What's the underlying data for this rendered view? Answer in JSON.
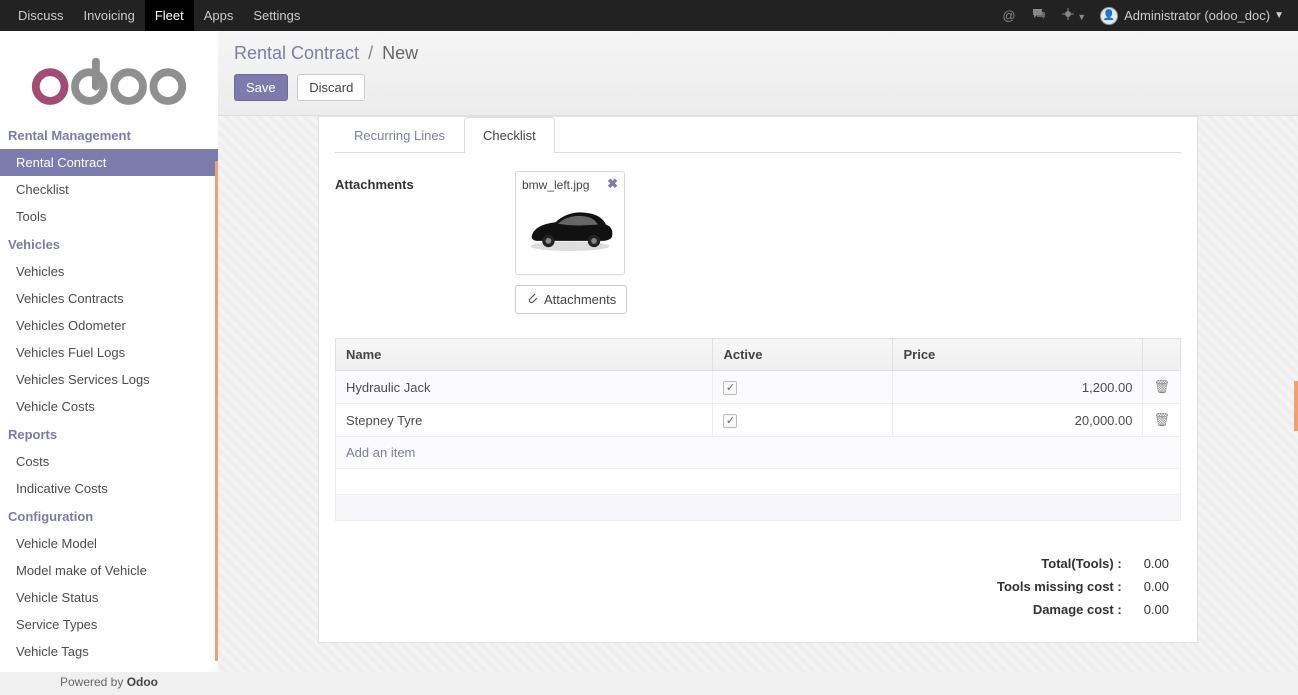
{
  "topnav": {
    "items": [
      "Discuss",
      "Invoicing",
      "Fleet",
      "Apps",
      "Settings"
    ],
    "active_index": 2,
    "user_label": "Administrator (odoo_doc)"
  },
  "sidebar": {
    "sections": [
      {
        "title": "Rental Management",
        "items": [
          "Rental Contract",
          "Checklist",
          "Tools"
        ],
        "active_item": 0
      },
      {
        "title": "Vehicles",
        "items": [
          "Vehicles",
          "Vehicles Contracts",
          "Vehicles Odometer",
          "Vehicles Fuel Logs",
          "Vehicles Services Logs",
          "Vehicle Costs"
        ]
      },
      {
        "title": "Reports",
        "items": [
          "Costs",
          "Indicative Costs"
        ]
      },
      {
        "title": "Configuration",
        "items": [
          "Vehicle Model",
          "Model make of Vehicle",
          "Vehicle Status",
          "Service Types",
          "Vehicle Tags"
        ]
      }
    ],
    "footer_prefix": "Powered by ",
    "footer_brand": "Odoo"
  },
  "header": {
    "breadcrumb_root": "Rental Contract",
    "breadcrumb_current": "New",
    "save_label": "Save",
    "discard_label": "Discard"
  },
  "tabs": {
    "items": [
      "Recurring Lines",
      "Checklist"
    ],
    "active_index": 1
  },
  "attachments": {
    "label": "Attachments",
    "button_label": "Attachments",
    "card_filename": "bmw_left.jpg"
  },
  "tools_table": {
    "columns": {
      "name": "Name",
      "active": "Active",
      "price": "Price"
    },
    "rows": [
      {
        "name": "Hydraulic Jack",
        "active": true,
        "price": "1,200.00"
      },
      {
        "name": "Stepney Tyre",
        "active": true,
        "price": "20,000.00"
      }
    ],
    "add_item_label": "Add an item"
  },
  "totals": {
    "rows": [
      {
        "label": "Total(Tools) :",
        "value": "0.00"
      },
      {
        "label": "Tools missing cost :",
        "value": "0.00"
      },
      {
        "label": "Damage cost :",
        "value": "0.00"
      }
    ]
  }
}
